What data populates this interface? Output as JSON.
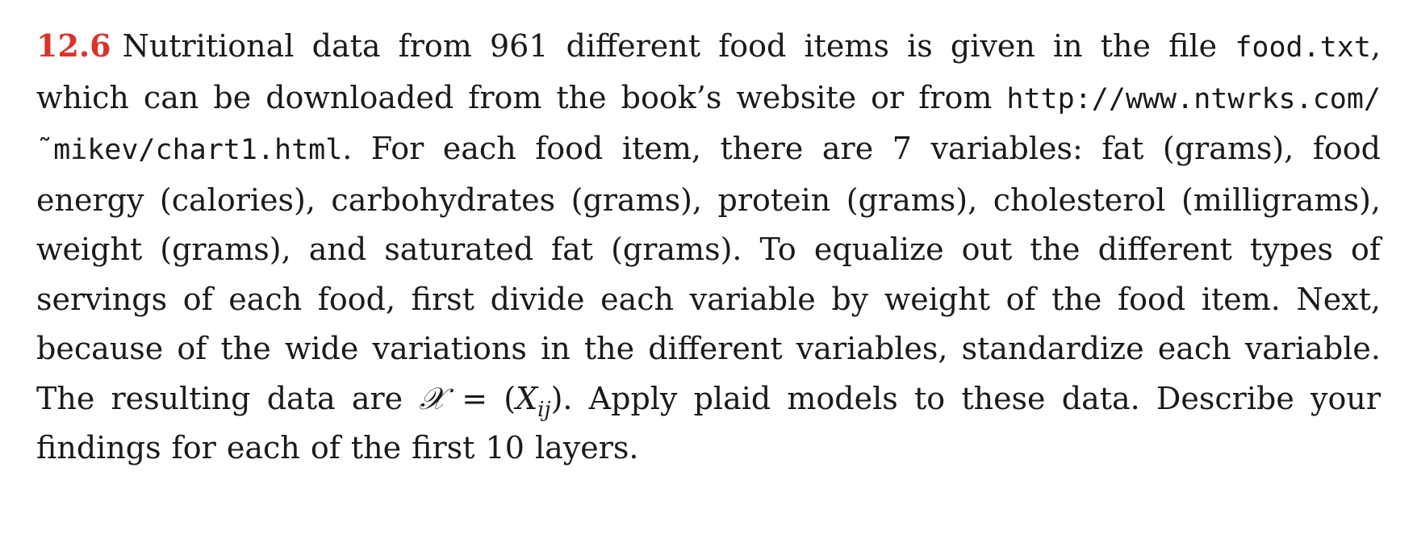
{
  "exercise": {
    "number": "12.6",
    "text_part1": "Nutritional data from 961 different food items is given in the file",
    "filename": "food.txt",
    "text_part2": ", which can be downloaded from the book’s website or from",
    "url": "http://www.ntwrks.com/˜mikev/chart1.html",
    "text_part3": ". For each food item, there are 7 variables: fat (grams), food energy (calories), carbohydrates (grams), protein (grams), cholesterol (milligrams), weight (grams), and saturated fat (grams). To equalize out the different types of servings of each food, first divide each variable by weight of the food item. Next, because of the wide variations in the different variables, standardize each variable. The resulting data are",
    "math_symbol": "𝒳",
    "math_equals": " = (",
    "math_var": "X",
    "math_sub": "ij",
    "math_close": ")",
    "text_part4": ". Apply plaid models to these data. Describe your findings for each of the first 10 layers."
  }
}
